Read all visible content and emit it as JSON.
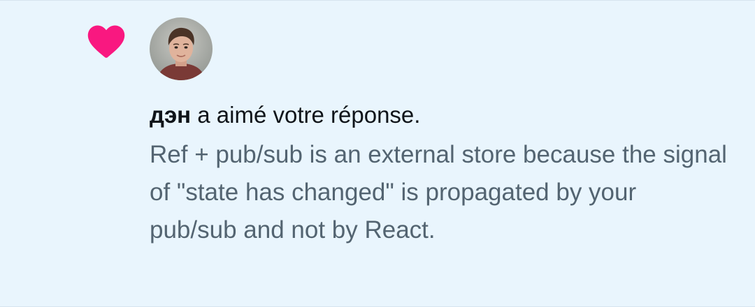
{
  "notification": {
    "user_name": "дэн",
    "action_text": " a aimé votre réponse.",
    "reply_text": "Ref + pub/sub is an external store because the signal of \"state has changed\" is propagated by your pub/sub and not by React.",
    "icon": "heart-icon",
    "heart_color": "#f91880",
    "avatar": "user-avatar"
  }
}
